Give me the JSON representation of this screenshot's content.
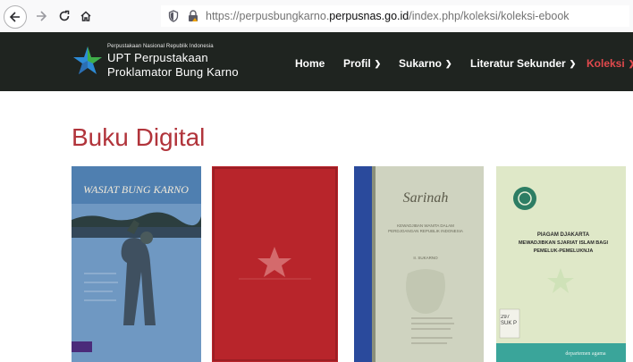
{
  "browser": {
    "url_prefix": "https://perpusbungkarno.",
    "url_domain": "perpusnas.go.id",
    "url_path": "/index.php/koleksi/koleksi-ebook"
  },
  "header": {
    "org_small": "Perpustakaan Nasional Republik Indonesia",
    "brand_line1": "UPT Perpustakaan",
    "brand_line2": "Proklamator Bung Karno",
    "menu": [
      {
        "label": "Home"
      },
      {
        "label": "Profil"
      },
      {
        "label": "Sukarno"
      },
      {
        "label": "Literatur Sekunder"
      },
      {
        "label": "Koleksi"
      }
    ],
    "colors": {
      "background": "#1f2420",
      "active": "#e2494d"
    }
  },
  "main": {
    "title": "Buku Digital",
    "books": [
      {
        "cover_title": "WASIAT BUNG KARNO",
        "cover_color": "#6f98c2"
      },
      {
        "cover_title": "",
        "cover_color": "#b8252b"
      },
      {
        "cover_title": "Sarinah",
        "cover_subtitle": "KEWADJIBAN WANITA DALAM PERDJOANGAN REPUBLIK INDONESIA",
        "cover_author": "Ir. SUKARNO",
        "cover_color": "#cfd3c0"
      },
      {
        "cover_title": "PIAGAM DJAKARTA",
        "cover_subtitle": "MEWADJIBKAN SJARIAT ISLAM BAGI PEMELUK-PEMELUKNJA",
        "cover_label": "297 SUK P",
        "cover_footer": "departemen agama",
        "cover_color": "#dfe8c8"
      }
    ]
  }
}
